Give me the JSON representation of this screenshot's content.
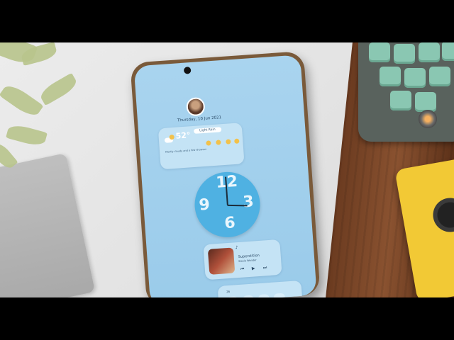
{
  "phone": {
    "date_text": "Thursday, 10 Jun 2021",
    "weather": {
      "temperature": "52°",
      "condition": "Light Rain",
      "detail": "Mostly cloudy and a few showers"
    },
    "clock": {
      "numerals": [
        "12",
        "3",
        "6",
        "9"
      ]
    },
    "music": {
      "song_title": "Superstition",
      "artist": "Stevie Wonder",
      "prev_symbol": "⏮",
      "play_symbol": "▶",
      "next_symbol": "⏭"
    },
    "bottom_widget": {
      "label": "26"
    }
  },
  "colors": {
    "screen": "#a9d4ef",
    "clock_face": "#4fb1e2",
    "card": "#c4e3f5",
    "keyboard_keys": "#8ac7b2",
    "yellow_device": "#f2c935"
  },
  "icons": [
    "weather-cloud-sun-icon",
    "sun-icon",
    "music-note-icon",
    "play-icon",
    "skip-prev-icon",
    "skip-next-icon"
  ]
}
